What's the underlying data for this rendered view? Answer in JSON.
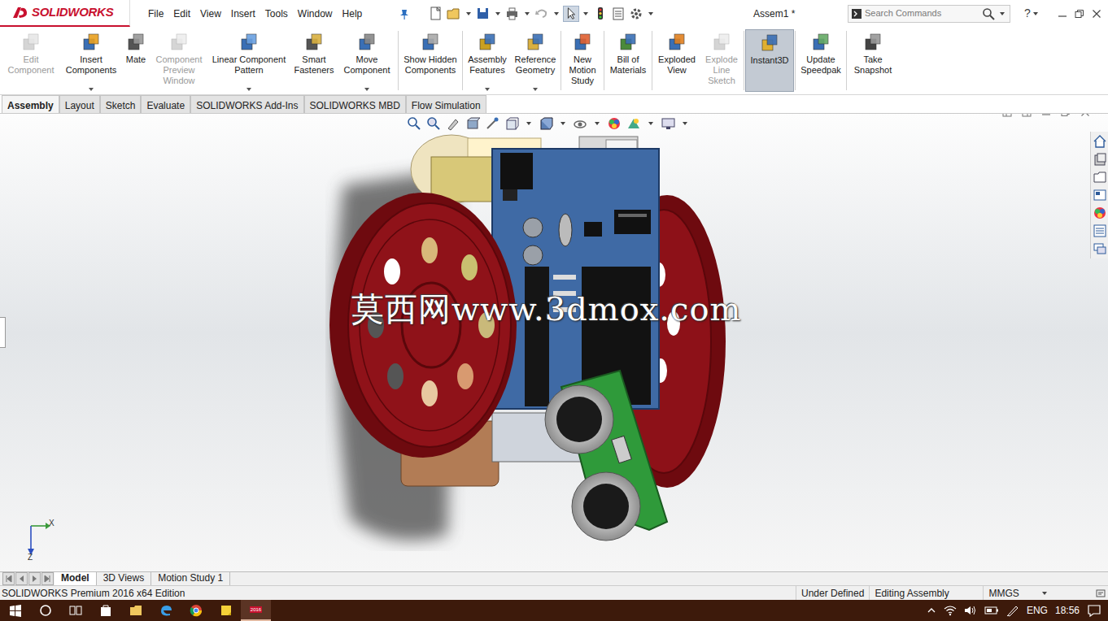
{
  "app": {
    "logo": "SOLIDWORKS"
  },
  "menu": [
    "File",
    "Edit",
    "View",
    "Insert",
    "Tools",
    "Window",
    "Help"
  ],
  "window": {
    "title": "Assem1 *"
  },
  "search": {
    "placeholder": "Search Commands"
  },
  "help": "?",
  "ribbon": [
    {
      "label": "Edit Component",
      "disabled": true,
      "selected": false,
      "dropdown": false
    },
    {
      "label": "Insert Components",
      "disabled": false,
      "selected": false,
      "dropdown": true
    },
    {
      "label": "Mate",
      "disabled": false,
      "selected": false,
      "dropdown": false
    },
    {
      "label": "Component Preview Window",
      "disabled": true,
      "selected": false,
      "dropdown": false
    },
    {
      "label": "Linear Component Pattern",
      "disabled": false,
      "selected": false,
      "dropdown": true
    },
    {
      "label": "Smart Fasteners",
      "disabled": false,
      "selected": false,
      "dropdown": false
    },
    {
      "label": "Move Component",
      "disabled": false,
      "selected": false,
      "dropdown": true
    },
    {
      "label": "Show Hidden Components",
      "disabled": false,
      "selected": false,
      "dropdown": false
    },
    {
      "label": "Assembly Features",
      "disabled": false,
      "selected": false,
      "dropdown": true
    },
    {
      "label": "Reference Geometry",
      "disabled": false,
      "selected": false,
      "dropdown": true
    },
    {
      "label": "New Motion Study",
      "disabled": false,
      "selected": false,
      "dropdown": false
    },
    {
      "label": "Bill of Materials",
      "disabled": false,
      "selected": false,
      "dropdown": false
    },
    {
      "label": "Exploded View",
      "disabled": false,
      "selected": false,
      "dropdown": false
    },
    {
      "label": "Explode Line Sketch",
      "disabled": true,
      "selected": false,
      "dropdown": false
    },
    {
      "label": "Instant3D",
      "disabled": false,
      "selected": true,
      "dropdown": false
    },
    {
      "label": "Update Speedpak",
      "disabled": false,
      "selected": false,
      "dropdown": false
    },
    {
      "label": "Take Snapshot",
      "disabled": false,
      "selected": false,
      "dropdown": false
    }
  ],
  "tabs": [
    {
      "label": "Assembly",
      "selected": true
    },
    {
      "label": "Layout",
      "selected": false
    },
    {
      "label": "Sketch",
      "selected": false
    },
    {
      "label": "Evaluate",
      "selected": false
    },
    {
      "label": "SOLIDWORKS Add-Ins",
      "selected": false
    },
    {
      "label": "SOLIDWORKS MBD",
      "selected": false
    },
    {
      "label": "Flow Simulation",
      "selected": false
    }
  ],
  "viewport": {
    "watermark": "莫西网www.3dmox.com",
    "axes": [
      "X",
      "Z"
    ]
  },
  "bottom_tabs": [
    {
      "label": "Model",
      "selected": true
    },
    {
      "label": "3D Views",
      "selected": false
    },
    {
      "label": "Motion Study 1",
      "selected": false
    }
  ],
  "status_bar": {
    "edition": "SOLIDWORKS Premium 2016 x64 Edition",
    "items": [
      "Under Defined",
      "Editing Assembly",
      "MMGS"
    ]
  },
  "taskbar": {
    "app_badge": "2016",
    "app_active": true,
    "language": "ENG",
    "clock": "18:56"
  }
}
